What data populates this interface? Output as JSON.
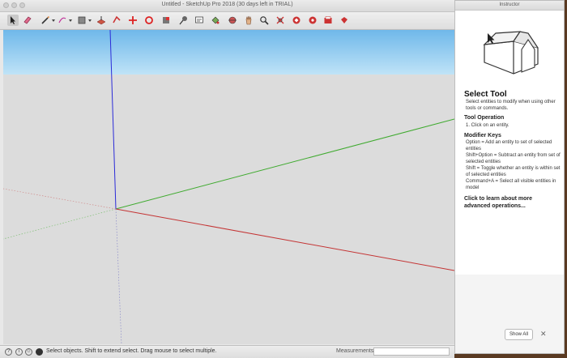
{
  "window": {
    "title": "Untitled - SketchUp Pro 2018 (30 days left in TRIAL)"
  },
  "toolbar": {
    "tools": [
      {
        "icon": "select-arrow-icon",
        "active": true
      },
      {
        "icon": "eraser-icon"
      },
      {
        "icon": "pencil-line-icon"
      },
      {
        "icon": "arc-icon"
      },
      {
        "icon": "rectangle-shape-icon"
      },
      {
        "icon": "push-pull-icon"
      },
      {
        "icon": "follow-me-icon"
      },
      {
        "icon": "move-icon"
      },
      {
        "icon": "rotate-icon"
      },
      {
        "icon": "scale-icon"
      },
      {
        "icon": "tape-measure-icon"
      },
      {
        "icon": "text-label-icon"
      },
      {
        "icon": "paint-bucket-icon"
      },
      {
        "icon": "orbit-icon"
      },
      {
        "icon": "pan-icon"
      },
      {
        "icon": "zoom-icon"
      },
      {
        "icon": "zoom-extents-icon"
      },
      {
        "icon": "3d-warehouse-icon"
      },
      {
        "icon": "extension-warehouse-icon"
      },
      {
        "icon": "layout-icon"
      },
      {
        "icon": "ruby-extension-icon"
      }
    ]
  },
  "viewport": {
    "sky_color": "#8fcff0",
    "ground_color": "#dcdcdc",
    "axis_colors": {
      "red": "#c43434",
      "green": "#3faa2f",
      "blue": "#2b2bd8"
    }
  },
  "status": {
    "text": "Select objects. Shift to extend select. Drag mouse to select multiple.",
    "measurements_label": "Measurements",
    "icons": [
      "geo-location-icon",
      "credits-icon",
      "user-icon",
      "layer-icon"
    ]
  },
  "instructor": {
    "title": "Instructor",
    "heading": "Select Tool",
    "description": "Select entities to modify when using other tools or commands.",
    "tool_operation_title": "Tool Operation",
    "tool_operation_text": "1. Click on an entity.",
    "modifier_keys_title": "Modifier Keys",
    "modifier_keys_lines": [
      "Option = Add an entity to set of selected entities",
      "Shift+Option = Subtract an entity from set of selected entities",
      "Shift = Toggle whether an entity is within set of selected entities",
      "Command+A = Select all visible entities in model"
    ],
    "learn_more": "Click to learn about more advanced operations...",
    "show_all_label": "Show All",
    "close_label": "✕"
  }
}
